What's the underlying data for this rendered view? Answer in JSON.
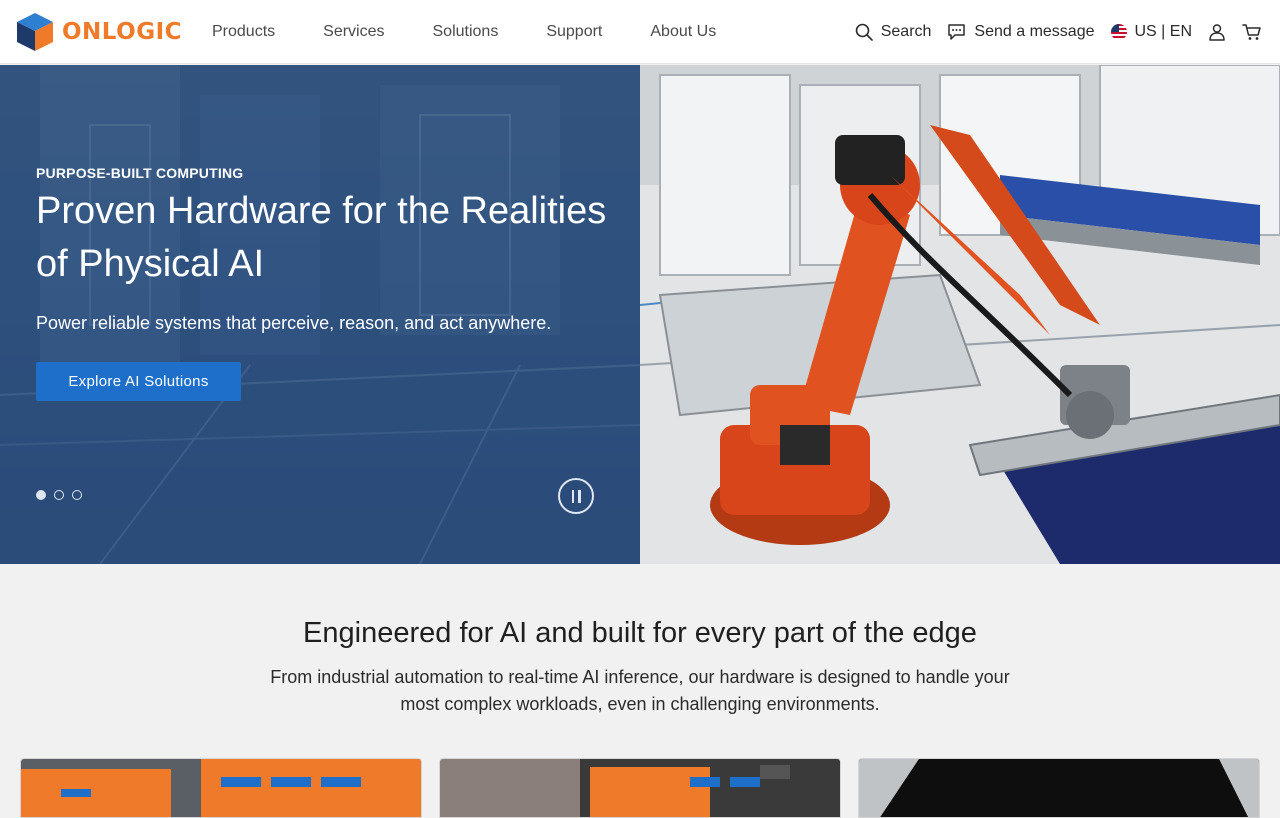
{
  "header": {
    "logo_text": "ONLOGIC",
    "nav": [
      "Products",
      "Services",
      "Solutions",
      "Support",
      "About Us"
    ],
    "search_label": "Search",
    "message_label": "Send a message",
    "locale_label": "US | EN"
  },
  "hero": {
    "eyebrow": "PURPOSE-BUILT COMPUTING",
    "title": "Proven Hardware for the Realities of Physical AI",
    "subtitle": "Power reliable systems that perceive, reason, and act anywhere.",
    "cta_label": "Explore AI Solutions",
    "slide_count": 3,
    "active_slide": 1
  },
  "section": {
    "title": "Engineered for AI and built for every part of the edge",
    "description": "From industrial automation to real-time AI inference, our hardware is designed to handle your most complex workloads, even in challenging environments."
  },
  "colors": {
    "brand_orange": "#ee7a2a",
    "brand_blue": "#1e6fc9",
    "hero_blue": "#274a78"
  }
}
